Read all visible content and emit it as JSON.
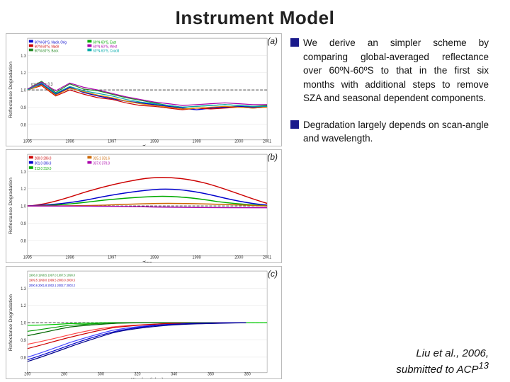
{
  "title": "Instrument Model",
  "charts": [
    {
      "id": "chart-a",
      "label": "(a)",
      "type": "time-series",
      "x_axis": "Time",
      "x_range": "1995-2004",
      "y_label": "Reflectance Degradation",
      "legend": [
        {
          "color": "#0000cc",
          "text": "60°N-60°S, Nadir, Orig"
        },
        {
          "color": "#cc0000",
          "text": "60°N-60°S, Nadir"
        },
        {
          "color": "#00aa00",
          "text": "60°N-60°S, Back"
        },
        {
          "color": "#aa00aa",
          "text": "60°N-60°S, East"
        },
        {
          "color": "#dd8800",
          "text": "60°N-60°S, West"
        },
        {
          "color": "#00aaaa",
          "text": "60°N-60°S, Coadd"
        }
      ],
      "note": "cos(θ₀ᴺ) + 0.3"
    },
    {
      "id": "chart-b",
      "label": "(b)",
      "type": "time-series",
      "x_axis": "Time",
      "x_range": "1995-2004",
      "y_label": "Reflectance Degradation",
      "legend": [
        {
          "color": "#cc0000",
          "text": "280.0  206.0"
        },
        {
          "color": "#0000cc",
          "text": "301.0  306.9"
        },
        {
          "color": "#00aa00",
          "text": "313.0  319.0"
        },
        {
          "color": "#cc6600",
          "text": "325.1  331.6"
        },
        {
          "color": "#aa00aa",
          "text": "337.0  370.0"
        }
      ]
    },
    {
      "id": "chart-c",
      "label": "(c)",
      "type": "wavelength-series",
      "x_axis": "Wavelength (nm)",
      "x_range": "260-380",
      "y_label": "Reflectance Degradation",
      "legend": [
        {
          "color": "#00aa00",
          "text": "1996.0  1998.5  1997.0  1997.5  1998.0"
        },
        {
          "color": "#cc0000",
          "text": "1999.5  1999.0  1999.5  2000.0  2000.5"
        },
        {
          "color": "#0000cc",
          "text": "2000.6  2001.8  2002.1  2002.7  2003.2"
        }
      ]
    }
  ],
  "text_blocks": [
    {
      "id": "block1",
      "bullet": "■",
      "content": "We derive an simpler scheme by comparing global-averaged reflectance over 60ºN-60ºS to that in the first six months with additional steps to remove SZA and seasonal dependent components."
    },
    {
      "id": "block2",
      "bullet": "■",
      "content": "Degradation largely depends on scan-angle and wavelength."
    }
  ],
  "citation": {
    "text": "Liu et al., 2006, submitted to ACP",
    "superscript": "13"
  }
}
